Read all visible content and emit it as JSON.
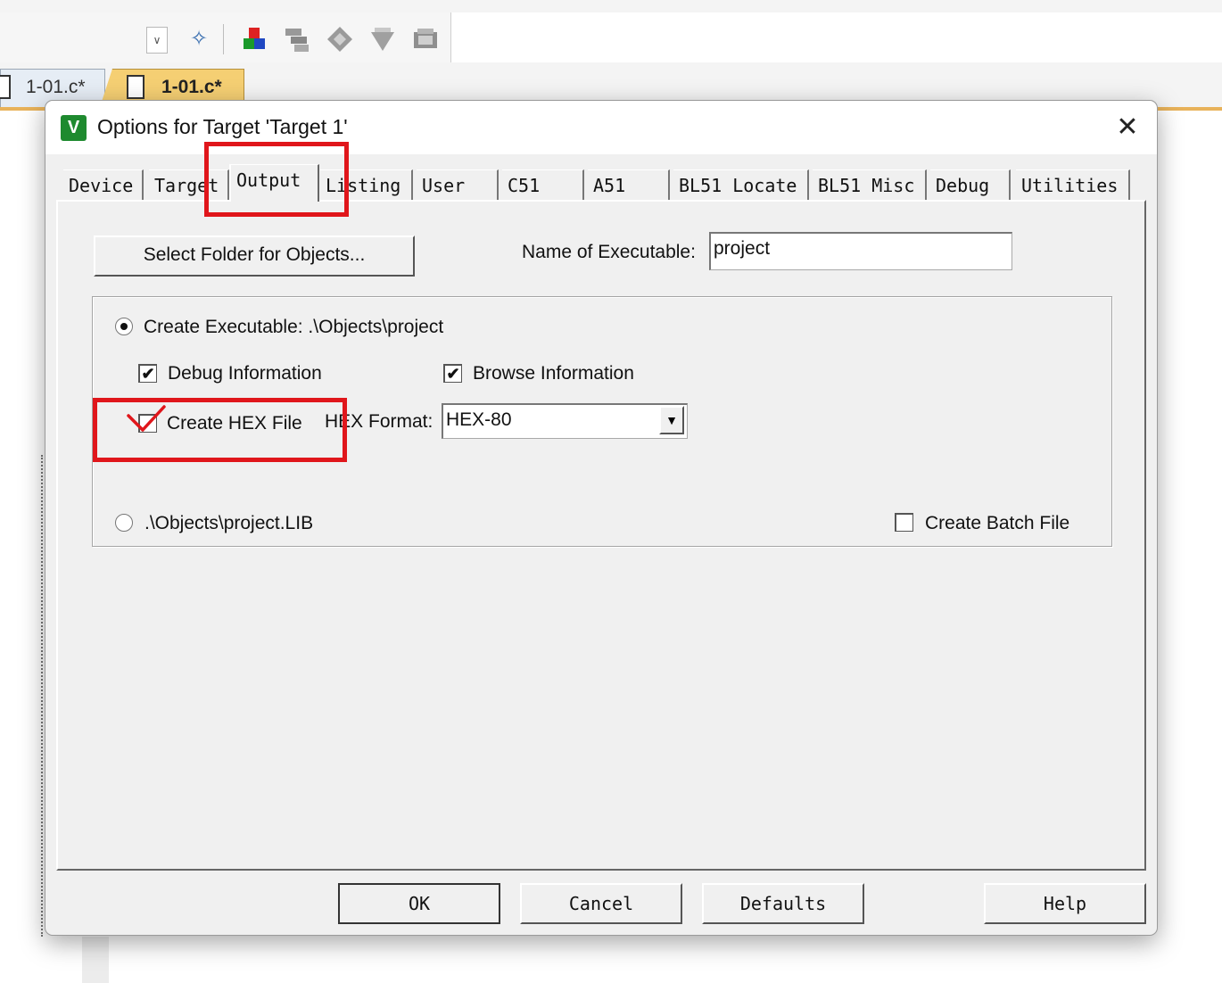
{
  "ide": {
    "doc_tabs": [
      {
        "label": "1-01.c*"
      },
      {
        "label": "1-01.c*"
      }
    ],
    "toolbar_icons": [
      "wand-icon",
      "rebuild-icon",
      "batch-build-icon",
      "diamond-icon",
      "download-icon",
      "pack-icon"
    ]
  },
  "dialog": {
    "title": "Options for Target 'Target 1'",
    "close": "✕",
    "icon_letter": "V",
    "tabs": [
      {
        "label": "Device"
      },
      {
        "label": "Target"
      },
      {
        "label": "Output"
      },
      {
        "label": "Listing"
      },
      {
        "label": "User"
      },
      {
        "label": "C51"
      },
      {
        "label": "A51"
      },
      {
        "label": "BL51 Locate"
      },
      {
        "label": "BL51 Misc"
      },
      {
        "label": "Debug"
      },
      {
        "label": "Utilities"
      }
    ],
    "active_tab": "Output",
    "output": {
      "select_folder_label": "Select Folder for Objects...",
      "name_of_executable_label": "Name of Executable:",
      "name_of_executable_value": "project",
      "create_executable_label": "Create Executable:  .\\Objects\\project",
      "create_executable_selected": true,
      "debug_information_label": "Debug Information",
      "debug_information_checked": true,
      "browse_information_label": "Browse Information",
      "browse_information_checked": true,
      "create_hex_label": "Create HEX File",
      "create_hex_checked": false,
      "hex_format_label": "HEX Format:",
      "hex_format_value": "HEX-80",
      "library_label": ".\\Objects\\project.LIB",
      "library_selected": false,
      "create_batch_label": "Create Batch File",
      "create_batch_checked": false
    },
    "buttons": {
      "ok": "OK",
      "cancel": "Cancel",
      "defaults": "Defaults",
      "help": "Help"
    }
  },
  "annotations": {
    "color": "#e0161b"
  }
}
